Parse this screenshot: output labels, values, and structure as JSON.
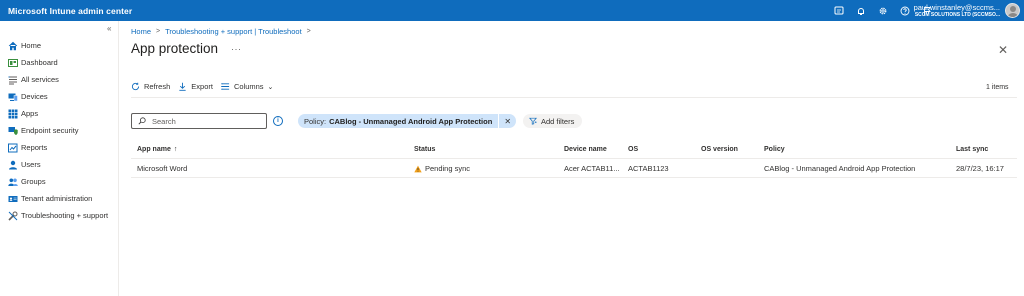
{
  "app": {
    "title": "Microsoft Intune admin center",
    "user_name": "paul.winstanley@sccms...",
    "user_tenant": "SCCM SOLUTIONS LTD (SCCMSO...",
    "top_icons": [
      "feedback-icon",
      "bell-icon",
      "gear-icon",
      "help-icon",
      "flag-icon"
    ]
  },
  "sidebar": {
    "collapse_glyph": "«",
    "items": [
      {
        "label": "Home",
        "icon": "home-icon"
      },
      {
        "label": "Dashboard",
        "icon": "dashboard-icon"
      },
      {
        "label": "All services",
        "icon": "all-services-icon"
      },
      {
        "label": "Devices",
        "icon": "devices-icon"
      },
      {
        "label": "Apps",
        "icon": "apps-icon"
      },
      {
        "label": "Endpoint security",
        "icon": "shield-icon"
      },
      {
        "label": "Reports",
        "icon": "reports-icon"
      },
      {
        "label": "Users",
        "icon": "user-icon"
      },
      {
        "label": "Groups",
        "icon": "groups-icon"
      },
      {
        "label": "Tenant administration",
        "icon": "tenant-icon"
      },
      {
        "label": "Troubleshooting + support",
        "icon": "wrench-icon"
      }
    ]
  },
  "breadcrumb": {
    "items": [
      "Home",
      "Troubleshooting + support | Troubleshoot"
    ],
    "separator": ">"
  },
  "page": {
    "title": "App protection",
    "more": "···",
    "close": "✕"
  },
  "toolbar": {
    "refresh": "Refresh",
    "export": "Export",
    "columns": "Columns",
    "columns_chevron": "⌄",
    "items_count": "1 items"
  },
  "search": {
    "placeholder": "Search",
    "value": ""
  },
  "filter": {
    "key": "Policy:",
    "value": "CABlog - Unmanaged Android App Protection",
    "remove": "✕",
    "add_label": "Add filters"
  },
  "table": {
    "columns": [
      "App name",
      "Status",
      "Device name",
      "OS",
      "OS version",
      "Policy",
      "Last sync"
    ],
    "sort_glyph": "↑",
    "rows": [
      {
        "app_name": "Microsoft Word",
        "status": "Pending sync",
        "device_name": "Acer ACTAB11...",
        "os": "ACTAB1123",
        "os_version": "",
        "policy": "CABlog - Unmanaged Android App Protection",
        "last_sync": "28/7/23, 16:17"
      }
    ]
  },
  "colors": {
    "accent": "#0f6cbd",
    "pill": "#cfe4fa",
    "warning": "#f2a01a"
  }
}
